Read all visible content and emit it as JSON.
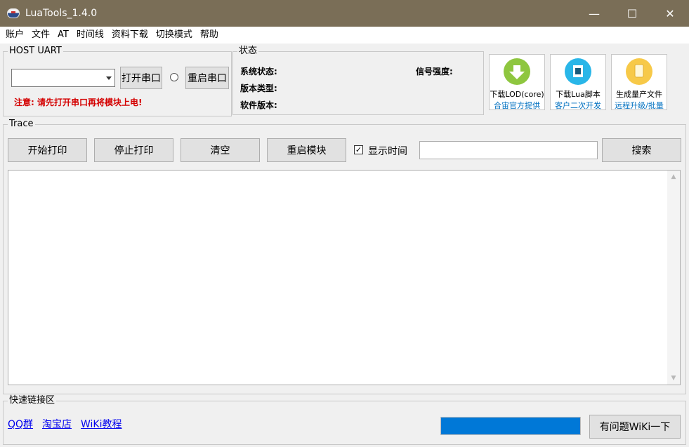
{
  "window": {
    "title": "LuaTools_1.4.0",
    "minimize_glyph": "—",
    "maximize_glyph": "☐",
    "close_glyph": "✕"
  },
  "menu": [
    "账户",
    "文件",
    "AT",
    "时间线",
    "资料下载",
    "切换模式",
    "帮助"
  ],
  "host_uart": {
    "legend": "HOST UART",
    "port_value": "",
    "open_label": "打开串口",
    "restart_label": "重启串口",
    "warning": "注意: 请先打开串口再将模块上电!"
  },
  "status": {
    "legend": "状态",
    "system_status": "系统状态:",
    "version_type": "版本类型:",
    "software_version": "软件版本:",
    "signal_strength": "信号强度:"
  },
  "tools": [
    {
      "line1": "下载LOD(core)",
      "line2": "合宙官方提供",
      "icon": "download-arrow-icon",
      "color": "#8ec63f"
    },
    {
      "line1": "下载Lua脚本",
      "line2": "客户二次开发",
      "icon": "script-icon",
      "color": "#29b6e8"
    },
    {
      "line1": "生成量产文件",
      "line2": "远程升级/批量",
      "icon": "document-icon",
      "color": "#f7c948"
    }
  ],
  "trace": {
    "legend": "Trace",
    "start_print": "开始打印",
    "stop_print": "停止打印",
    "clear": "清空",
    "restart_module": "重启模块",
    "show_time": "显示时间",
    "show_time_checked": true,
    "search_value": "",
    "search_button": "搜索",
    "output": ""
  },
  "quick_links": {
    "legend": "快速链接区",
    "links": [
      "QQ群",
      "淘宝店",
      "WiKi教程"
    ],
    "progress_percent": 100,
    "wiki_button": "有问题WiKi一下"
  }
}
